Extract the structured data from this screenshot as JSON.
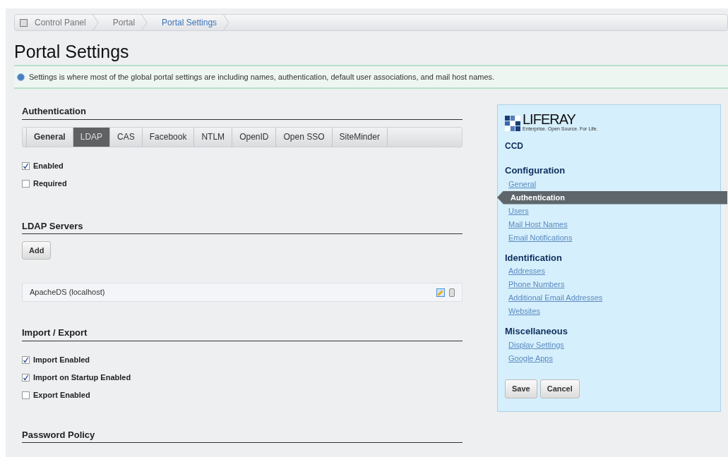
{
  "breadcrumb": [
    {
      "label": "Control Panel",
      "selected": false
    },
    {
      "label": "Portal",
      "selected": false
    },
    {
      "label": "Portal Settings",
      "selected": true
    }
  ],
  "title": "Portal Settings",
  "info": "Settings is where most of the global portal settings are including names, authentication, default user associations, and mail host names.",
  "sections": [
    {
      "kind": "auth",
      "heading": "Authentication",
      "tabs": [
        {
          "label": "General",
          "selected": false
        },
        {
          "label": "LDAP",
          "selected": true
        },
        {
          "label": "CAS",
          "selected": false
        },
        {
          "label": "Facebook",
          "selected": false
        },
        {
          "label": "NTLM",
          "selected": false
        },
        {
          "label": "OpenID",
          "selected": false
        },
        {
          "label": "Open SSO",
          "selected": false
        },
        {
          "label": "SiteMinder",
          "selected": false
        }
      ],
      "checkboxes": [
        {
          "label": "Enabled",
          "checked": true
        },
        {
          "label": "Required",
          "checked": false
        }
      ]
    },
    {
      "kind": "servers",
      "heading": "LDAP Servers",
      "button": "Add",
      "servers": [
        "ApacheDS (localhost)"
      ]
    },
    {
      "kind": "checks",
      "heading": "Import / Export",
      "checkboxes": [
        {
          "label": "Import Enabled",
          "checked": true
        },
        {
          "label": "Import on Startup Enabled",
          "checked": true
        },
        {
          "label": "Export Enabled",
          "checked": false
        }
      ]
    },
    {
      "kind": "checks",
      "heading": "Password Policy"
    }
  ],
  "panel": {
    "logo": "LIFERAY",
    "tagline": "Enterprise. Open Source. For Life.",
    "site": "CCD",
    "groups": [
      {
        "heading": "Configuration",
        "items": [
          {
            "label": "General",
            "selected": false
          },
          {
            "label": "Authentication",
            "selected": true
          },
          {
            "label": "Users",
            "selected": false
          },
          {
            "label": "Mail Host Names",
            "selected": false
          },
          {
            "label": "Email Notifications",
            "selected": false
          }
        ]
      },
      {
        "heading": "Identification",
        "items": [
          {
            "label": "Addresses",
            "selected": false
          },
          {
            "label": "Phone Numbers",
            "selected": false
          },
          {
            "label": "Additional Email Addresses",
            "selected": false
          },
          {
            "label": "Websites",
            "selected": false
          }
        ]
      },
      {
        "heading": "Miscellaneous",
        "items": [
          {
            "label": "Display Settings",
            "selected": false
          },
          {
            "label": "Google Apps",
            "selected": false
          }
        ]
      }
    ],
    "buttons": [
      "Save",
      "Cancel"
    ]
  }
}
